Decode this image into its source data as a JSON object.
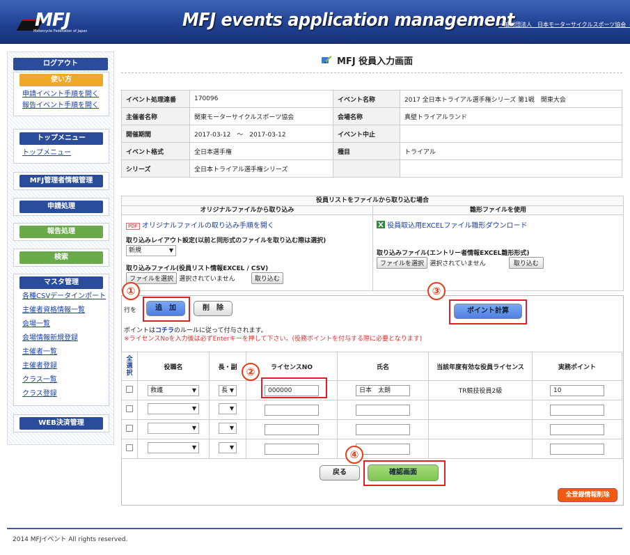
{
  "header": {
    "logo_text": "MFJ",
    "logo_sub": "Motorcycle Federation of Japan",
    "title": "MFJ events application management",
    "org_link": "一般財団法人　日本モーターサイクルスポーツ協会（ＭＦＪ）"
  },
  "sidebar": {
    "logout": "ログアウト",
    "usage_head": "使い方",
    "usage_links": [
      "申請イベント手順を開く",
      "報告イベント手順を開く"
    ],
    "top_head": "トップメニュー",
    "top_links": [
      "トップメニュー"
    ],
    "admin_head": "MFJ管理者情報管理",
    "apply_head": "申請処理",
    "report_head": "報告処理",
    "search_head": "検索",
    "master_head": "マスタ管理",
    "master_links": [
      "各種CSVデータインポート",
      "主催者資格情報一覧",
      "会場一覧",
      "会場情報新規登録",
      "主催者一覧",
      "主催者登録",
      "クラス一覧",
      "クラス登録"
    ],
    "web_head": "WEB決済管理"
  },
  "page": {
    "heading": "MFJ 役員入力画面"
  },
  "info": {
    "rows": [
      {
        "k1": "イベント処理連番",
        "v1": "170096",
        "k2": "イベント名称",
        "v2": "2017 全日本トライアル選手権シリーズ 第1戦　関東大会"
      },
      {
        "k1": "主催者名称",
        "v1": "関東モーターサイクルスポーツ協会",
        "k2": "会場名称",
        "v2": "真壁トライアルランド"
      },
      {
        "k1": "開催期間",
        "v1": "2017-03-12　～　2017-03-12",
        "k2": "イベント中止",
        "v2": ""
      },
      {
        "k1": "イベント格式",
        "v1": "全日本選手権",
        "k2": "種目",
        "v2": "トライアル"
      },
      {
        "k1": "シリーズ",
        "v1": "全日本トライアル選手権シリーズ",
        "k2": "",
        "v2": ""
      }
    ]
  },
  "import": {
    "title": "役員リストをファイルから取り込む場合",
    "left_head": "オリジナルファイルから取り込み",
    "right_head": "雛形ファイルを使用",
    "pdf_badge": "PDF",
    "left_link": "オリジナルファイルの取り込み手順を開く",
    "right_link": "役員取込用EXCELファイル雛形ダウンロード",
    "layout_label": "取り込みレイアウト設定(以前と同形式のファイルを取り込む際は選択)",
    "layout_value": "新規",
    "left_file_label": "取り込みファイル(役員リスト情報EXCEL / CSV)",
    "right_file_label": "取り込みファイル(エントリー者情報EXCEL雛形形式)",
    "choose_file": "ファイルを選択",
    "no_file": "選択されていません",
    "import_btn": "取り込む"
  },
  "controls": {
    "row_label": "行を",
    "add_btn": "追　加",
    "delete_btn": "削　除",
    "points_btn": "ポイント計算",
    "note_prefix": "ポイントは",
    "note_link": "コチラ",
    "note_suffix": "のルールに従って付与されます。",
    "note_red": "※ライセンスNoを入力後は必ずEnterキーを押して下さい。(役務ポイントを付与する際に必要となります)"
  },
  "table": {
    "headers": [
      "全選択",
      "役職名",
      "長・副",
      "ライセンスNO",
      "氏名",
      "当該年度有効な役員ライセンス",
      "実務ポイント"
    ],
    "rows": [
      {
        "role": "救護",
        "chief": "長",
        "license": "000000",
        "name": "日本　太朗",
        "valid": "TR競技役員2級",
        "points": "10"
      },
      {
        "role": "",
        "chief": "",
        "license": "",
        "name": "",
        "valid": "",
        "points": ""
      },
      {
        "role": "",
        "chief": "",
        "license": "",
        "name": "",
        "valid": "",
        "points": ""
      },
      {
        "role": "",
        "chief": "",
        "license": "",
        "name": "",
        "valid": "",
        "points": ""
      }
    ]
  },
  "actions": {
    "back_btn": "戻る",
    "confirm_btn": "確認画面",
    "delete_all_btn": "全登録情報削除"
  },
  "markers": [
    "①",
    "②",
    "③",
    "④"
  ],
  "footer": {
    "copyright": "2014 MFJイベント All rights reserved."
  },
  "colors": {
    "header_blue": "#1f3f8f",
    "sidebar_blue": "#2b4c9b",
    "sidebar_orange": "#f0a828",
    "sidebar_green": "#6aaa4a",
    "highlight_red": "#e02020",
    "add_button_blue": "#5b8de8",
    "confirm_green": "#8ccf5a",
    "delete_all_orange": "#f05a10"
  }
}
